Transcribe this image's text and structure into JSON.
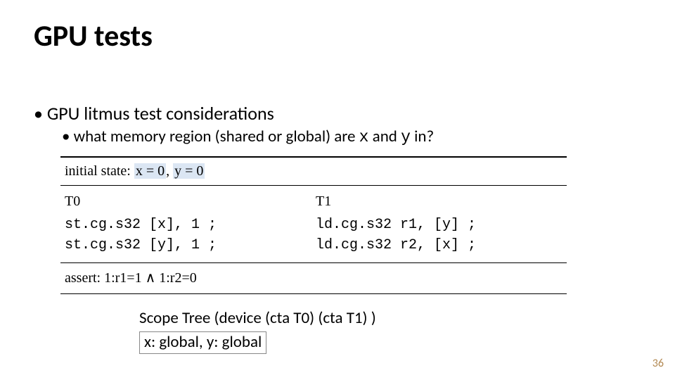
{
  "title": "GPU tests",
  "bullets": {
    "b1": "GPU litmus test considerations",
    "b2_pre": "what memory region (shared or global) are ",
    "varx": "x",
    "b2_mid": " and ",
    "vary": "y",
    "b2_post": " in?"
  },
  "litmus": {
    "init_label": "initial state: ",
    "init_x": "x = 0",
    "comma": ", ",
    "init_y": "y = 0",
    "t0": {
      "name": "T0",
      "l1": "st.cg.s32 [x], 1 ;",
      "l2": "st.cg.s32 [y], 1 ;"
    },
    "t1": {
      "name": "T1",
      "l1": "ld.cg.s32 r1, [y] ;",
      "l2": "ld.cg.s32 r2, [x] ;"
    },
    "assert": "assert: 1:r1=1 ∧ 1:r2=0"
  },
  "scope_tree": "Scope Tree (device (cta T0) (cta T1) )",
  "mem_regions": "x: global, y: global",
  "page": "36"
}
